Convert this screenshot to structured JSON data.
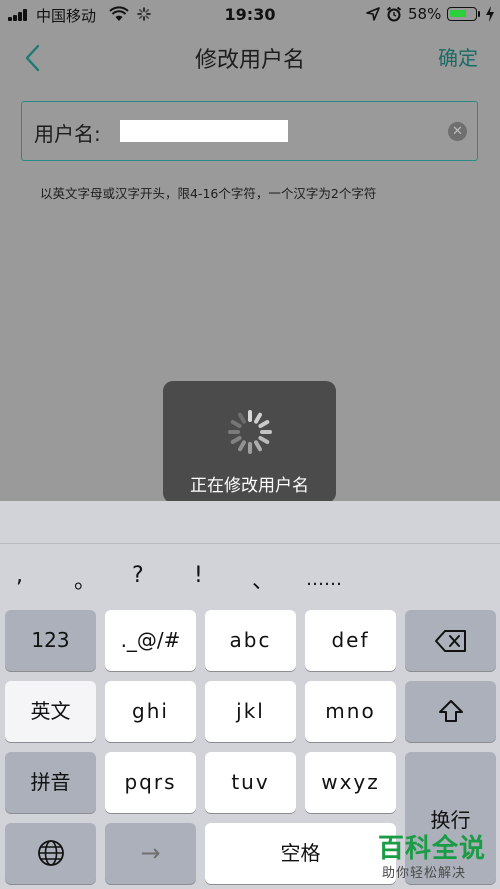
{
  "status": {
    "carrier": "中国移动",
    "time": "19:30",
    "battery": "58%"
  },
  "nav": {
    "title": "修改用户名",
    "confirm": "确定"
  },
  "form": {
    "label": "用户名:",
    "hint": "以英文字母或汉字开头，限4-16个字符，一个汉字为2个字符"
  },
  "toast": {
    "message": "正在修改用户名"
  },
  "keyboard": {
    "punct": [
      ",",
      "。",
      "?",
      "!",
      "、",
      "……"
    ],
    "key_123": "123",
    "key_symbols": "._@/#",
    "key_abc": "abc",
    "key_def": "def",
    "key_english": "英文",
    "key_ghi": "ghi",
    "key_jkl": "jkl",
    "key_mno": "mno",
    "key_pinyin": "拼音",
    "key_pqrs": "pqrs",
    "key_tuv": "tuv",
    "key_wxyz": "wxyz",
    "key_return": "换行",
    "key_space": "空格",
    "key_arrow": "→"
  },
  "watermark": {
    "main": "百科全说",
    "sub": "助你轻松解决"
  },
  "colors": {
    "accent": "#2a8b84",
    "battery_fill": "#2bd13c",
    "watermark": "#1a9c45"
  }
}
